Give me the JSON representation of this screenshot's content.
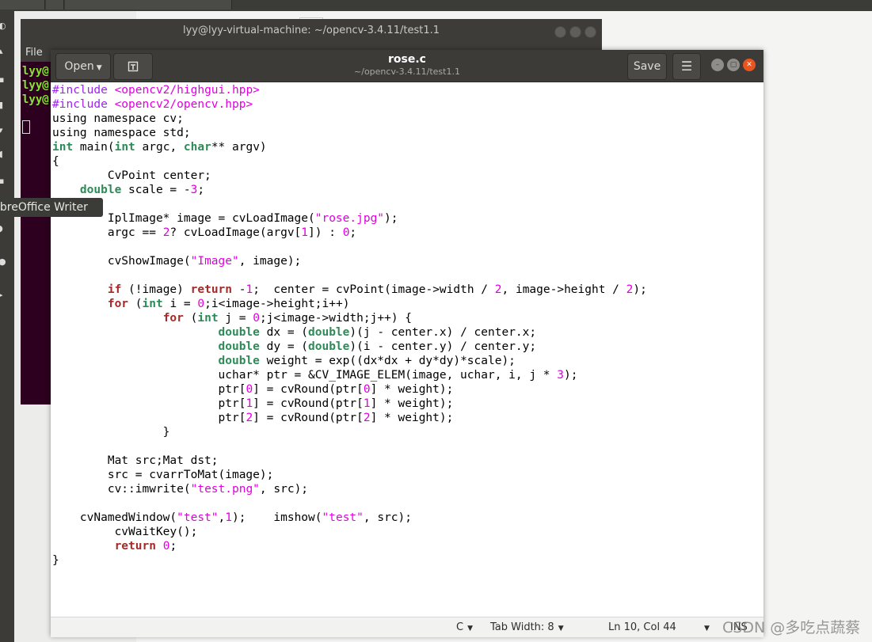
{
  "terminal": {
    "title": "lyy@lyy-virtual-machine: ~/opencv-3.4.11/test1.1",
    "menu_file": "File",
    "prompt_lines": [
      "lyy@",
      "lyy@",
      "lyy@"
    ]
  },
  "tooltip": {
    "text": "ibreOffice Writer"
  },
  "gedit": {
    "open_label": "Open",
    "save_label": "Save",
    "file_name": "rose.c",
    "file_path": "~/opencv-3.4.11/test1.1",
    "code_lines": [
      "#include <opencv2/highgui.hpp>",
      "#include <opencv2/opencv.hpp>",
      "using namespace cv;",
      "using namespace std;",
      "int main(int argc, char** argv)",
      "{",
      "        CvPoint center;",
      "    double scale = -3;",
      "",
      "        IplImage* image = cvLoadImage(\"rose.jpg\");",
      "        argc == 2? cvLoadImage(argv[1]) : 0;",
      "",
      "        cvShowImage(\"Image\", image);",
      "",
      "        if (!image) return -1;  center = cvPoint(image->width / 2, image->height / 2);",
      "        for (int i = 0;i<image->height;i++)",
      "                for (int j = 0;j<image->width;j++) {",
      "                        double dx = (double)(j - center.x) / center.x;",
      "                        double dy = (double)(i - center.y) / center.y;",
      "                        double weight = exp((dx*dx + dy*dy)*scale);",
      "                        uchar* ptr = &CV_IMAGE_ELEM(image, uchar, i, j * 3);",
      "                        ptr[0] = cvRound(ptr[0] * weight);",
      "                        ptr[1] = cvRound(ptr[1] * weight);",
      "                        ptr[2] = cvRound(ptr[2] * weight);",
      "                }",
      "",
      "        Mat src;Mat dst;",
      "        src = cvarrToMat(image);",
      "        cv::imwrite(\"test.png\", src);",
      "",
      "    cvNamedWindow(\"test\",1);    imshow(\"test\", src);",
      "         cvWaitKey();",
      "         return 0;",
      "}"
    ],
    "status": {
      "language": "C",
      "tab_width": "Tab Width: 8",
      "position": "Ln 10, Col 44",
      "mode": "INS"
    }
  },
  "watermark": "CSDN @多吃点蔬蔡",
  "icons": {
    "open_caret": "chevron-down-icon",
    "new_document": "new-document-icon",
    "menu": "hamburger-menu-icon",
    "minimize": "minimize-icon",
    "maximize": "maximize-icon",
    "close": "close-icon"
  },
  "colors": {
    "headerbar": "#3c3b37",
    "terminal_bg": "#2c001e",
    "keyword": "#2e8b57",
    "string": "#e000e0",
    "close_button": "#e95420"
  }
}
